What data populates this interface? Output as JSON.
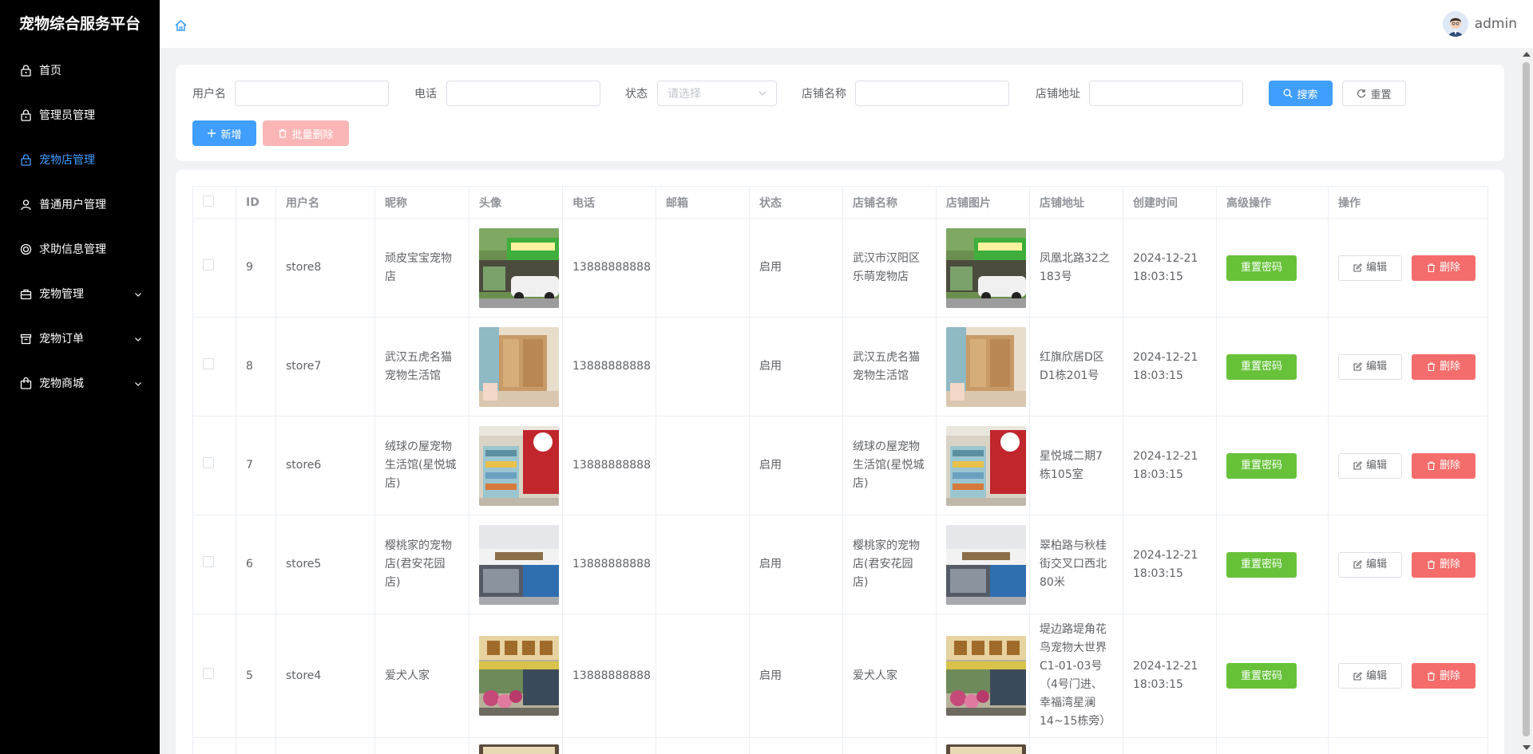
{
  "brand": "宠物综合服务平台",
  "menu": [
    {
      "label": "首页",
      "icon": "lock-icon",
      "active": false,
      "has_arrow": false
    },
    {
      "label": "管理员管理",
      "icon": "lock-icon",
      "active": false,
      "has_arrow": false
    },
    {
      "label": "宠物店管理",
      "icon": "lock-icon",
      "active": true,
      "has_arrow": false
    },
    {
      "label": "普通用户管理",
      "icon": "user-icon",
      "active": false,
      "has_arrow": false
    },
    {
      "label": "求助信息管理",
      "icon": "help-icon",
      "active": false,
      "has_arrow": false
    },
    {
      "label": "宠物管理",
      "icon": "briefcase-icon",
      "active": false,
      "has_arrow": true
    },
    {
      "label": "宠物订单",
      "icon": "box-icon",
      "active": false,
      "has_arrow": true
    },
    {
      "label": "宠物商城",
      "icon": "bag-icon",
      "active": false,
      "has_arrow": true
    }
  ],
  "header": {
    "username": "admin"
  },
  "search": {
    "username_label": "用户名",
    "phone_label": "电话",
    "status_label": "状态",
    "status_placeholder": "请选择",
    "store_name_label": "店铺名称",
    "store_address_label": "店铺地址",
    "search_button": "搜索",
    "reset_button": "重置",
    "add_button": "新增",
    "batch_delete_button": "批量删除"
  },
  "table": {
    "columns": [
      "ID",
      "用户名",
      "昵称",
      "头像",
      "电话",
      "邮箱",
      "状态",
      "店铺名称",
      "店铺图片",
      "店铺地址",
      "创建时间",
      "高级操作",
      "操作"
    ],
    "reset_password_label": "重置密码",
    "edit_label": "编辑",
    "delete_label": "删除",
    "rows": [
      {
        "id": "9",
        "username": "store8",
        "nickname": "顽皮宝宝宠物店",
        "phone": "13888888888",
        "email": "",
        "status": "启用",
        "store_name": "武汉市汉阳区乐萌宠物店",
        "address": "凤凰北路32之183号",
        "created": "2024-12-21 18:03:15",
        "img": "green"
      },
      {
        "id": "8",
        "username": "store7",
        "nickname": "武汉五虎名猫宠物生活馆",
        "phone": "13888888888",
        "email": "",
        "status": "启用",
        "store_name": "武汉五虎名猫宠物生活馆",
        "address": "红旗欣居D区D1栋201号",
        "created": "2024-12-21 18:03:15",
        "img": "wood"
      },
      {
        "id": "7",
        "username": "store6",
        "nickname": "绒球の屋宠物生活馆(星悦城店)",
        "phone": "13888888888",
        "email": "",
        "status": "启用",
        "store_name": "绒球の屋宠物生活馆(星悦城店)",
        "address": "星悦城二期7栋105室",
        "created": "2024-12-21 18:03:15",
        "img": "red"
      },
      {
        "id": "6",
        "username": "store5",
        "nickname": "樱桃家的宠物店(君安花园店)",
        "phone": "13888888888",
        "email": "",
        "status": "启用",
        "store_name": "樱桃家的宠物店(君安花园店)",
        "address": "翠柏路与秋桂街交叉口西北80米",
        "created": "2024-12-21 18:03:15",
        "img": "street"
      },
      {
        "id": "5",
        "username": "store4",
        "nickname": "爱犬人家",
        "phone": "13888888888",
        "email": "",
        "status": "启用",
        "store_name": "爱犬人家",
        "address": "堤边路堤角花鸟宠物大世界C1-01-03号（4号门进、幸福湾星澜14~15栋旁）",
        "created": "2024-12-21 18:03:15",
        "img": "flowers"
      }
    ]
  }
}
